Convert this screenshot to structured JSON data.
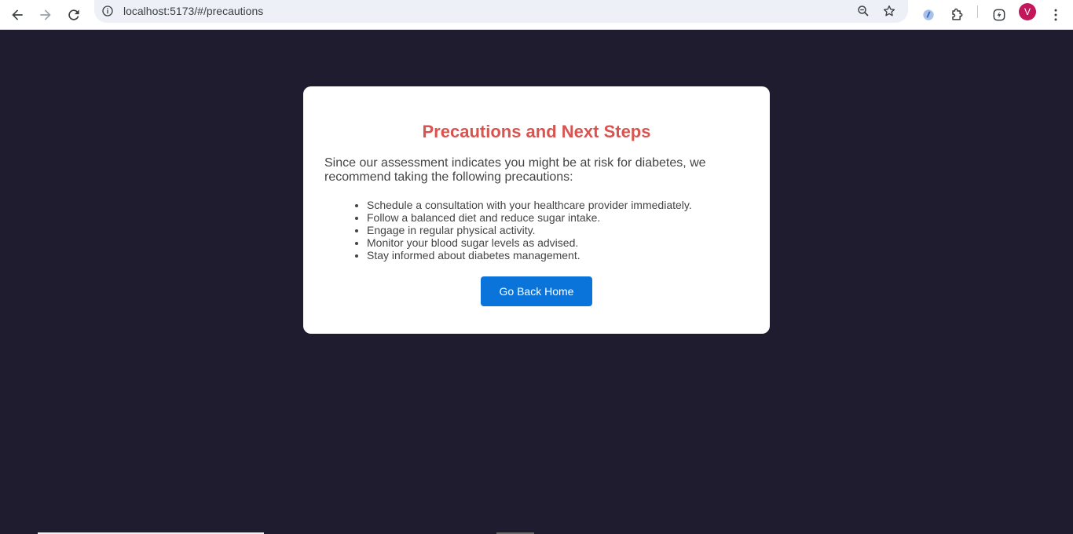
{
  "browser": {
    "url": "localhost:5173/#/precautions",
    "profile_initial": "V",
    "icons": {
      "back": "arrow-left-icon",
      "forward": "arrow-right-icon",
      "reload": "reload-icon",
      "site_info": "info-icon",
      "zoom": "zoom-icon",
      "bookmark": "star-icon",
      "extension_1": "extension-badge-icon",
      "extensions": "puzzle-icon",
      "extension_2": "lightning-icon",
      "menu": "kebab-menu-icon"
    },
    "colors": {
      "profile": "#c2185b"
    }
  },
  "page": {
    "background": "#1e1c2e",
    "card": {
      "title": "Precautions and Next Steps",
      "intro": "Since our assessment indicates you might be at risk for diabetes, we recommend taking the following precautions:",
      "items": [
        "Schedule a consultation with your healthcare provider immediately.",
        "Follow a balanced diet and reduce sugar intake.",
        "Engage in regular physical activity.",
        "Monitor your blood sugar levels as advised.",
        "Stay informed about diabetes management."
      ],
      "button_label": "Go Back Home"
    },
    "colors": {
      "title": "#d9534f",
      "button": "#0a74da",
      "text": "#444444"
    }
  }
}
